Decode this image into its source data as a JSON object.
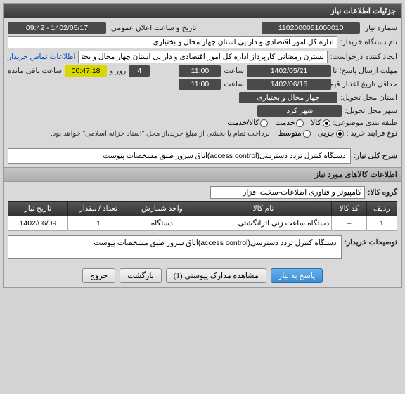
{
  "header": {
    "title": "جزئیات اطلاعات نیاز"
  },
  "fields": {
    "need_no_label": "شماره نیاز:",
    "need_no": "1102000051000010",
    "announce_label": "تاریخ و ساعت اعلان عمومی:",
    "announce_value": "1402/05/17 - 09:42",
    "buyer_label": "نام دستگاه خریدار:",
    "buyer_value": "اداره کل امور اقتصادی و دارایی استان چهار محال و بختیاری",
    "requester_label": "ایجاد کننده درخواست:",
    "requester_value": "نسترن رمضانی کارپرداز اداره کل امور اقتصادی و دارایی استان چهار محال و بختی",
    "contact_link": "اطلاعات تماس خریدار",
    "reply_until_label": "مهلت ارسال پاسخ؛ تا تاریخ:",
    "reply_until_date": "1402/05/21",
    "hour_label": "ساعت",
    "reply_until_time": "11:00",
    "day_label": "روز و",
    "days_left": "4",
    "time_left": "00:47:18",
    "time_left_label": "ساعت باقی مانده",
    "validity_label": "حداقل تاریخ اعتبار قیمت؛ تا تاریخ:",
    "validity_date": "1402/06/16",
    "validity_time": "11:00",
    "delivery_prov_label": "استان محل تحویل:",
    "delivery_prov": "چهار محال و بختیاری",
    "delivery_city_label": "شهر محل تحویل:",
    "delivery_city": "شهر کرد",
    "category_label": "طبقه بندی موضوعی:",
    "cat_goods": "کالا",
    "cat_service": "خدمت",
    "cat_goods_service": "کالا/خدمت",
    "process_label": "نوع فرآیند خرید :",
    "proc_partial": "جزیی",
    "proc_medium": "متوسط",
    "proc_note": "پرداخت تمام یا بخشی از مبلغ خرید،از محل \"اسناد خزانه اسلامی\" خواهد بود."
  },
  "need_desc": {
    "label": "شرح کلی نیاز:",
    "value": "دستگاه کنترل تردد دسترسی(access control)اتاق سرور طبق مشخصات پیوست"
  },
  "items_section": {
    "title": "اطلاعات کالاهای مورد نیاز",
    "group_label": "گروه کالا:",
    "group_value": "کامپیوتر و فناوری اطلاعات-سخت افزار"
  },
  "table": {
    "headers": [
      "ردیف",
      "کد کالا",
      "نام کالا",
      "واحد شمارش",
      "تعداد / مقدار",
      "تاریخ نیاز"
    ],
    "rows": [
      {
        "idx": "1",
        "code": "--",
        "name": "دستگاه ساعت زنی اثرانگشتی",
        "unit": "دستگاه",
        "qty": "1",
        "date": "1402/06/09"
      }
    ]
  },
  "buyer_notes": {
    "label": "توضیحات خریدار:",
    "value": "دستگاه کنترل تردد دسترسی(access control)اتاق سرور طبق مشخصات پیوست"
  },
  "buttons": {
    "reply": "پاسخ به نیاز",
    "attachments": "مشاهده مدارک پیوستی (1)",
    "back": "بازگشت",
    "exit": "خروج"
  }
}
